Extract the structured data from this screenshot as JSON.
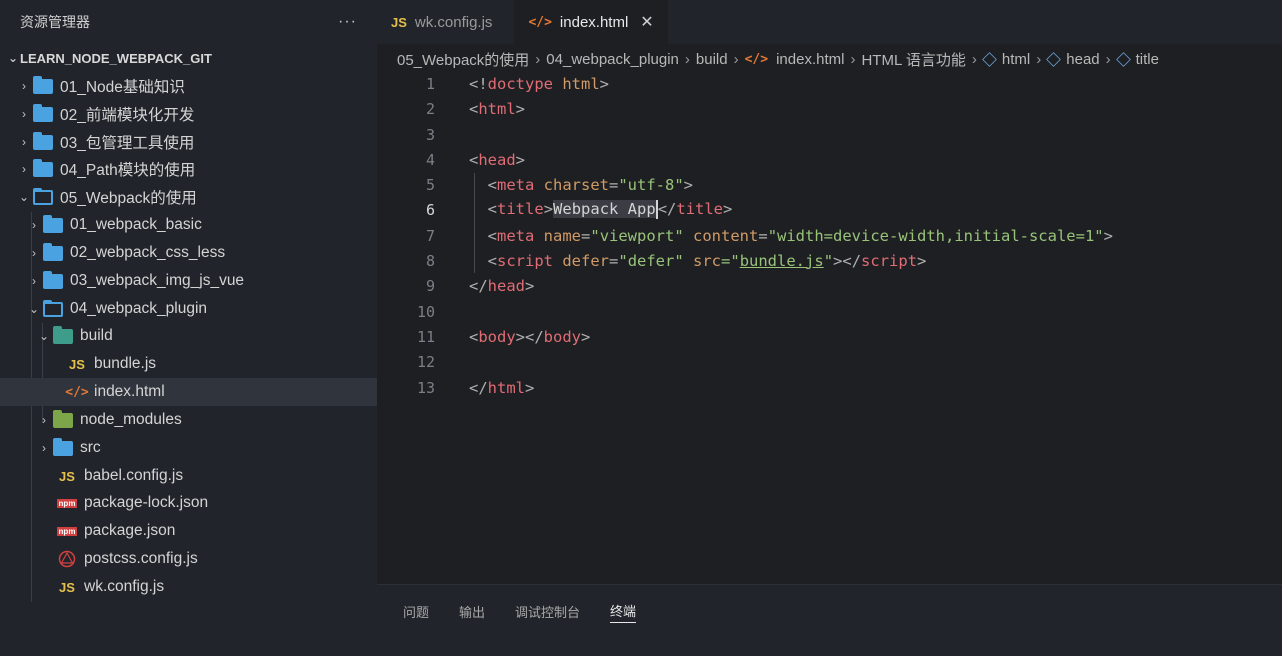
{
  "sidebar": {
    "title": "资源管理器",
    "more": "···",
    "root": "LEARN_NODE_WEBPACK_GIT",
    "items": [
      {
        "label": "01_Node基础知识",
        "type": "folder"
      },
      {
        "label": "02_前端模块化开发",
        "type": "folder"
      },
      {
        "label": "03_包管理工具使用",
        "type": "folder"
      },
      {
        "label": "04_Path模块的使用",
        "type": "folder"
      },
      {
        "label": "05_Webpack的使用",
        "type": "folder-open"
      },
      {
        "label": "01_webpack_basic",
        "type": "folder"
      },
      {
        "label": "02_webpack_css_less",
        "type": "folder"
      },
      {
        "label": "03_webpack_img_js_vue",
        "type": "folder"
      },
      {
        "label": "04_webpack_plugin",
        "type": "folder-open"
      },
      {
        "label": "build",
        "type": "folder-build"
      },
      {
        "label": "bundle.js",
        "type": "js",
        "icon_text": "JS"
      },
      {
        "label": "index.html",
        "type": "html",
        "icon_text": "</>"
      },
      {
        "label": "node_modules",
        "type": "folder-node"
      },
      {
        "label": "src",
        "type": "folder"
      },
      {
        "label": "babel.config.js",
        "type": "js",
        "icon_text": "JS"
      },
      {
        "label": "package-lock.json",
        "type": "npm",
        "icon_text": "npm"
      },
      {
        "label": "package.json",
        "type": "npm",
        "icon_text": "npm"
      },
      {
        "label": "postcss.config.js",
        "type": "postcss"
      },
      {
        "label": "wk.config.js",
        "type": "js",
        "icon_text": "JS"
      }
    ]
  },
  "tabs": [
    {
      "label": "wk.config.js",
      "icon_text": "JS"
    },
    {
      "label": "index.html",
      "icon_text": "</>",
      "close": "✕"
    }
  ],
  "breadcrumb": {
    "parts": [
      "05_Webpack的使用",
      "04_webpack_plugin",
      "build",
      "index.html",
      "HTML 语言功能",
      "html",
      "head",
      "title"
    ],
    "html_icon": "</>"
  },
  "code": {
    "line_numbers": [
      "1",
      "2",
      "3",
      "4",
      "5",
      "6",
      "7",
      "8",
      "9",
      "10",
      "11",
      "12",
      "13"
    ],
    "l1": {
      "a": "<!",
      "b": "doctype",
      "c": " html",
      "d": ">"
    },
    "l2": {
      "a": "<",
      "b": "html",
      "c": ">"
    },
    "l4": {
      "a": "<",
      "b": "head",
      "c": ">"
    },
    "l5": {
      "a": "<",
      "b": "meta",
      "c": " charset",
      "d": "=",
      "e": "\"utf-8\"",
      "f": ">"
    },
    "l6": {
      "a": "<",
      "b": "title",
      "c": ">",
      "d": "Webpack App",
      "e": "</",
      "f": "title",
      "g": ">"
    },
    "l7": {
      "a": "<",
      "b": "meta",
      "c": " name",
      "d": "=",
      "e": "\"viewport\"",
      "f": " content",
      "g": "=",
      "h": "\"width=device-width,initial-scale=1\"",
      "i": ">"
    },
    "l8": {
      "a": "<",
      "b": "script",
      "c": " defer",
      "d": "=",
      "e": "\"defer\"",
      "f": " src",
      "g": "=\"",
      "h": "bundle.js",
      "i": "\"",
      "j": "></",
      "k": "script",
      "l": ">"
    },
    "l9": {
      "a": "</",
      "b": "head",
      "c": ">"
    },
    "l11": {
      "a": "<",
      "b": "body",
      "c": "></",
      "d": "body",
      "e": ">"
    },
    "l13": {
      "a": "</",
      "b": "html",
      "c": ">"
    }
  },
  "panel": {
    "tabs": [
      "问题",
      "输出",
      "调试控制台",
      "终端"
    ],
    "active": "终端"
  },
  "colors": {
    "tag": "#e06c75",
    "attr": "#d19a66",
    "string": "#98c379",
    "folder": "#4aa3e0",
    "js": "#e6c04c"
  }
}
